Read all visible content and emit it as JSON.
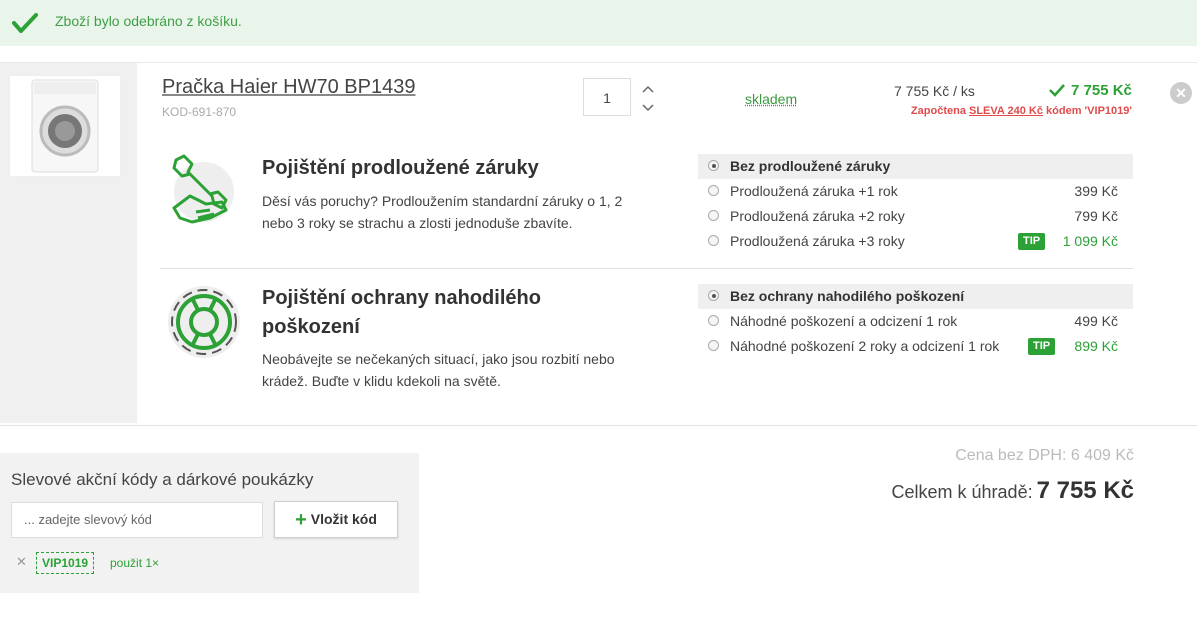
{
  "notice": {
    "message": "Zboží bylo odebráno z košíku."
  },
  "product": {
    "name": "Pračka Haier HW70 BP1439",
    "code": "KOD-691-870",
    "quantity": "1",
    "availability": "skladem",
    "unit_price": "7 755 Kč / ks",
    "total_price": "7 755 Kč",
    "discount_prefix": "Započtena",
    "discount_code_label": "SLEVA 240 Kč",
    "discount_suffix": "kódem 'VIP1019'"
  },
  "warranty": {
    "title_line1": "Pojištění prodloužené záruky",
    "desc_line1": "Děsí vás poruchy? Prodloužením standardní záruky o 1, 2",
    "desc_line2": "nebo 3 roky se strachu a zlosti jednoduše zbavíte.",
    "options": [
      {
        "label": "Bez prodloužené záruky",
        "price": "",
        "selected": true
      },
      {
        "label": "Prodloužená záruka +1 rok",
        "price": "399 Kč"
      },
      {
        "label": "Prodloužená záruka +2 roky",
        "price": "799 Kč"
      },
      {
        "label": "Prodloužená záruka +3 roky",
        "price": "1 099 Kč",
        "tip": "TIP"
      }
    ]
  },
  "damage": {
    "title_line1": "Pojištění ochrany nahodilého",
    "title_line2": "poškození",
    "desc_line1": "Neobávejte se nečekaných situací, jako jsou rozbití nebo",
    "desc_line2": "krádež. Buďte v klidu kdekoli na světě.",
    "options": [
      {
        "label": "Bez ochrany nahodilého poškození",
        "price": "",
        "selected": true
      },
      {
        "label": "Náhodné poškození a odcizení 1 rok",
        "price": "499 Kč"
      },
      {
        "label": "Náhodné poškození 2 roky a odcizení 1 rok",
        "price": "899 Kč",
        "tip": "TIP"
      }
    ]
  },
  "coupon": {
    "title": "Slevové akční kódy a dárkové poukázky",
    "placeholder": "... zadejte slevový kód",
    "apply_label": "Vložit kód",
    "applied_code": "VIP1019",
    "applied_usage": "použit 1×"
  },
  "totals": {
    "net_label": "Cena bez DPH: 6 409 Kč",
    "total_label": "Celkem k úhradě:",
    "total_value": "7 755 Kč"
  },
  "colors": {
    "accent_green": "#2ca135",
    "discount_red": "#e04b4b",
    "notice_bg": "#e9f5ea"
  }
}
